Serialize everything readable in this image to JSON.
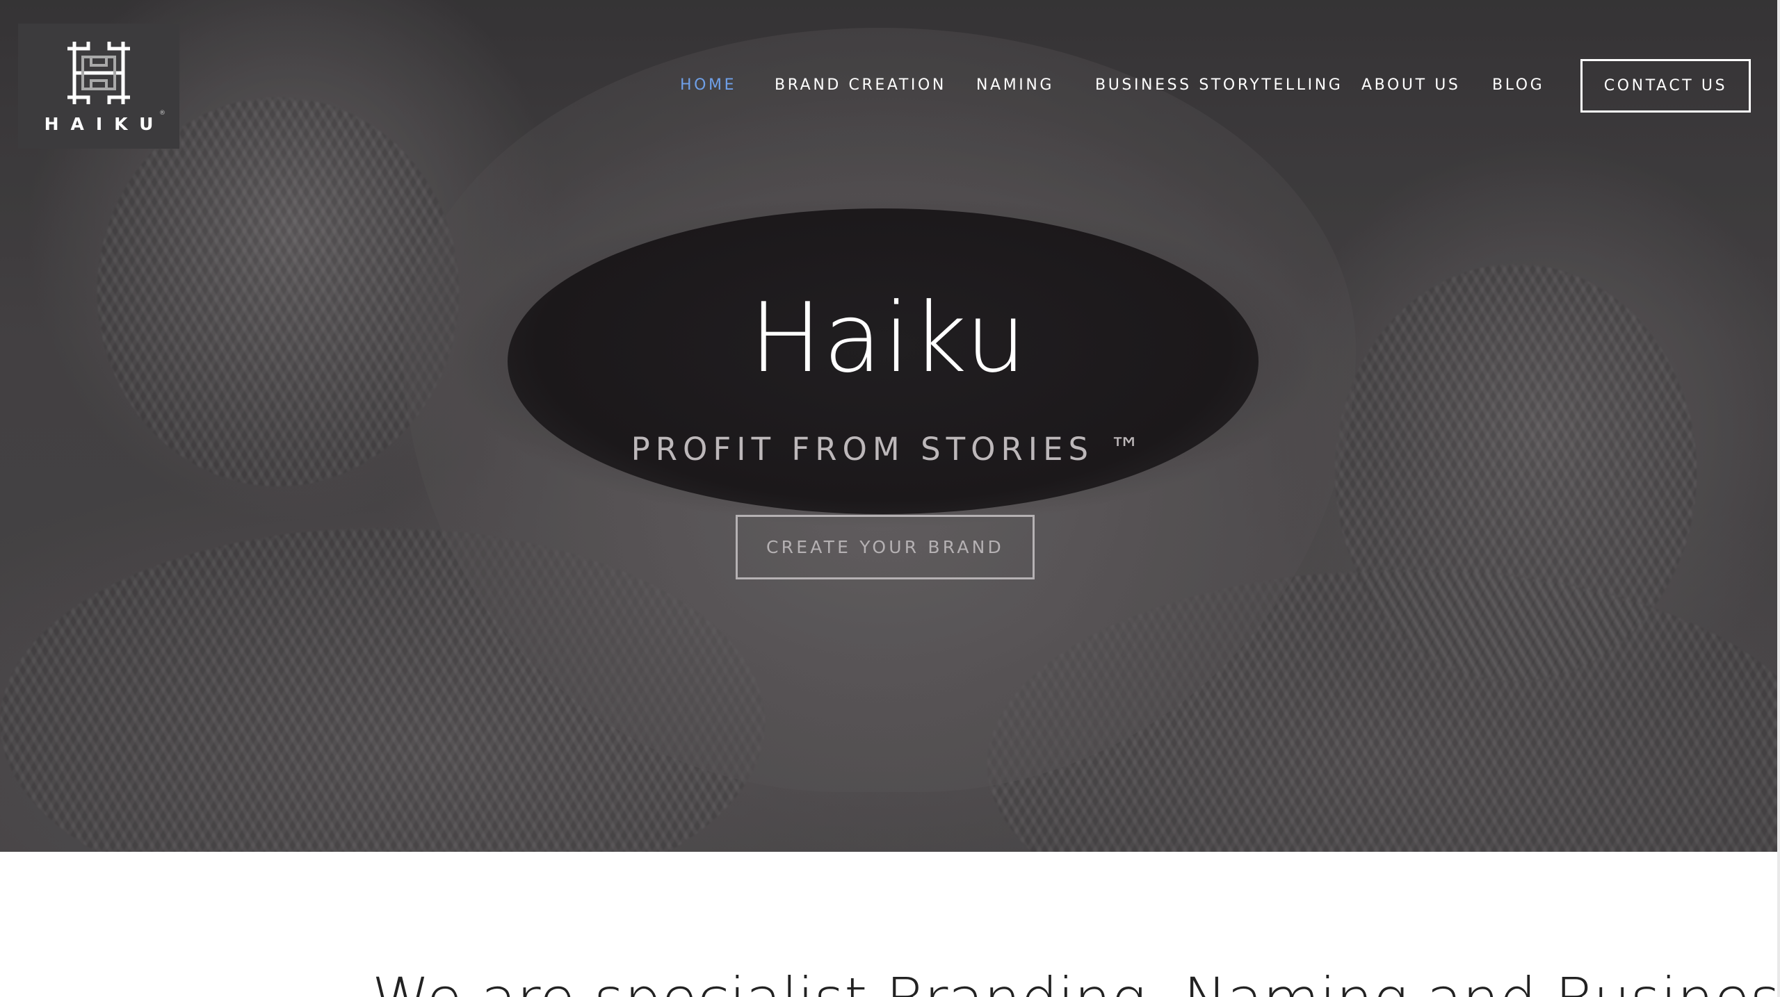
{
  "brand": {
    "logo_text": "HAIKU",
    "registered": "®"
  },
  "nav": {
    "items": [
      {
        "label": "HOME",
        "active": true
      },
      {
        "label": "BRAND CREATION",
        "active": false
      },
      {
        "label": "NAMING",
        "active": false
      },
      {
        "label": "BUSINESS STORYTELLING",
        "active": false
      },
      {
        "label": "ABOUT US",
        "active": false
      },
      {
        "label": "BLOG",
        "active": false
      }
    ],
    "contact_label": "CONTACT US"
  },
  "hero": {
    "title": "Haiku",
    "subtitle": "PROFIT FROM STORIES ™",
    "cta_label": "CREATE YOUR BRAND",
    "background_icon": "coffee-mug-knit-sweater-photo"
  },
  "intro": {
    "heading": "We are specialist Branding, Naming and Business"
  },
  "colors": {
    "nav_active": "#6fa0e8",
    "nav_text": "#ffffff",
    "logo_bg": "#3c3b3d",
    "cta_border": "#b5b1b3"
  }
}
